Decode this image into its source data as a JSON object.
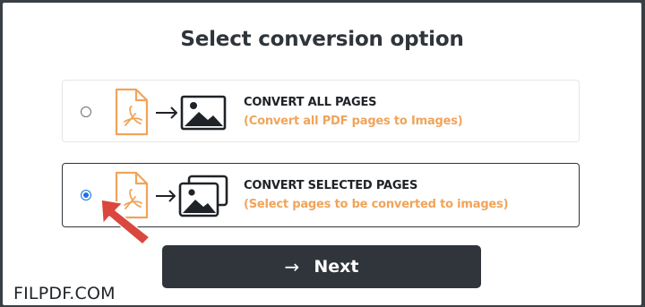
{
  "dialog": {
    "title": "Select conversion option"
  },
  "options": [
    {
      "title": "CONVERT ALL PAGES",
      "subtitle": "(Convert all PDF pages to Images)",
      "selected": false,
      "icon": "pdf-to-image-icon"
    },
    {
      "title": "CONVERT SELECTED PAGES",
      "subtitle": "(Select pages to be converted to images)",
      "selected": true,
      "icon": "pdf-to-images-icon"
    }
  ],
  "next_button": {
    "arrow": "→",
    "label": "Next"
  },
  "watermark": "FILPDF.COM",
  "colors": {
    "accent_orange": "#f0a45a",
    "dark": "#2f353b",
    "radio_blue": "#1a73e8",
    "pointer_red": "#d9473f"
  }
}
